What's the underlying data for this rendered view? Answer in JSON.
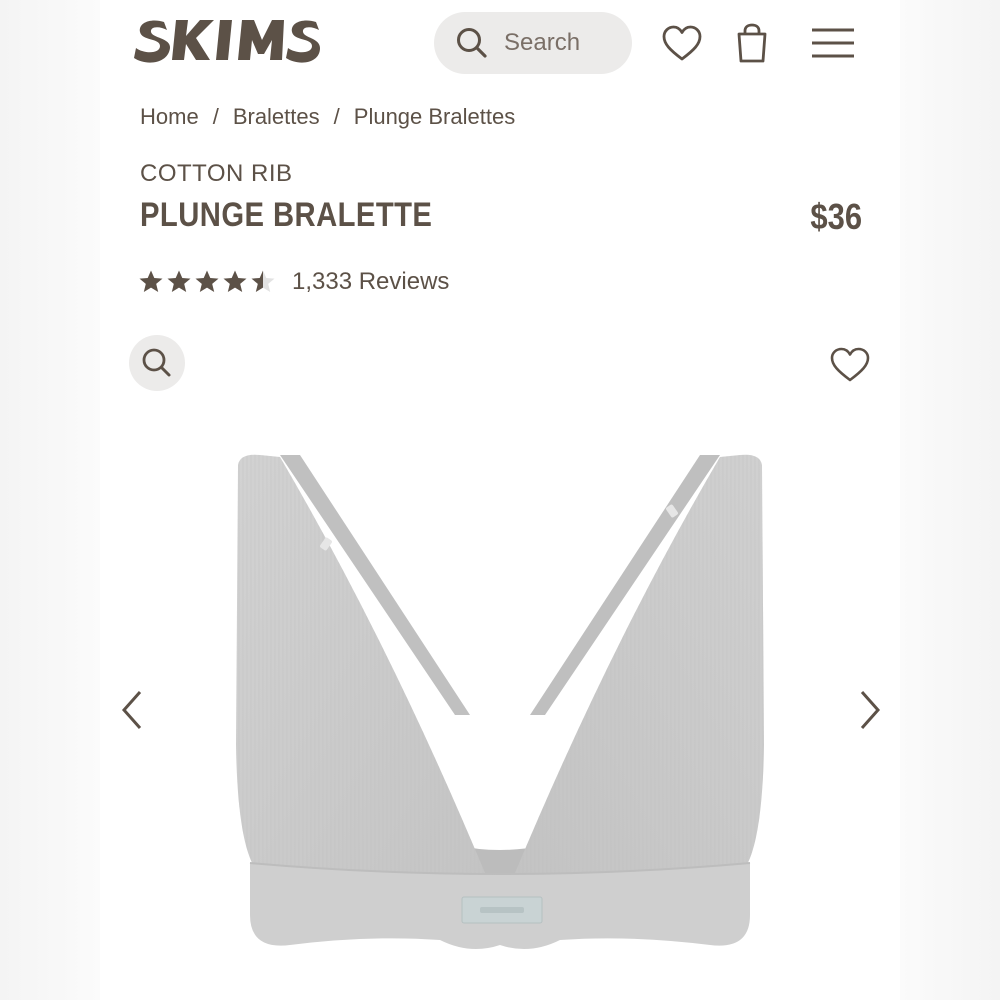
{
  "header": {
    "logo_text": "SKIMS",
    "search_placeholder": "Search",
    "icons": [
      "search-icon",
      "heart-icon",
      "shopping-bag-icon",
      "menu-icon"
    ]
  },
  "breadcrumb": [
    "Home",
    "Bralettes",
    "Plunge Bralettes"
  ],
  "breadcrumb_separator": "/",
  "product": {
    "collection": "COTTON RIB",
    "name": "PLUNGE BRALETTE",
    "price": "$36",
    "rating_value": 4.5,
    "rating_max": 5,
    "reviews_label": "1,333 Reviews"
  },
  "gallery": {
    "icons": [
      "zoom-icon",
      "heart-icon",
      "chevron-left-icon",
      "chevron-right-icon"
    ]
  },
  "colors": {
    "brand_text": "#5c5147",
    "pill_bg": "#ecebea",
    "product_gray": "#c9c9c9"
  }
}
